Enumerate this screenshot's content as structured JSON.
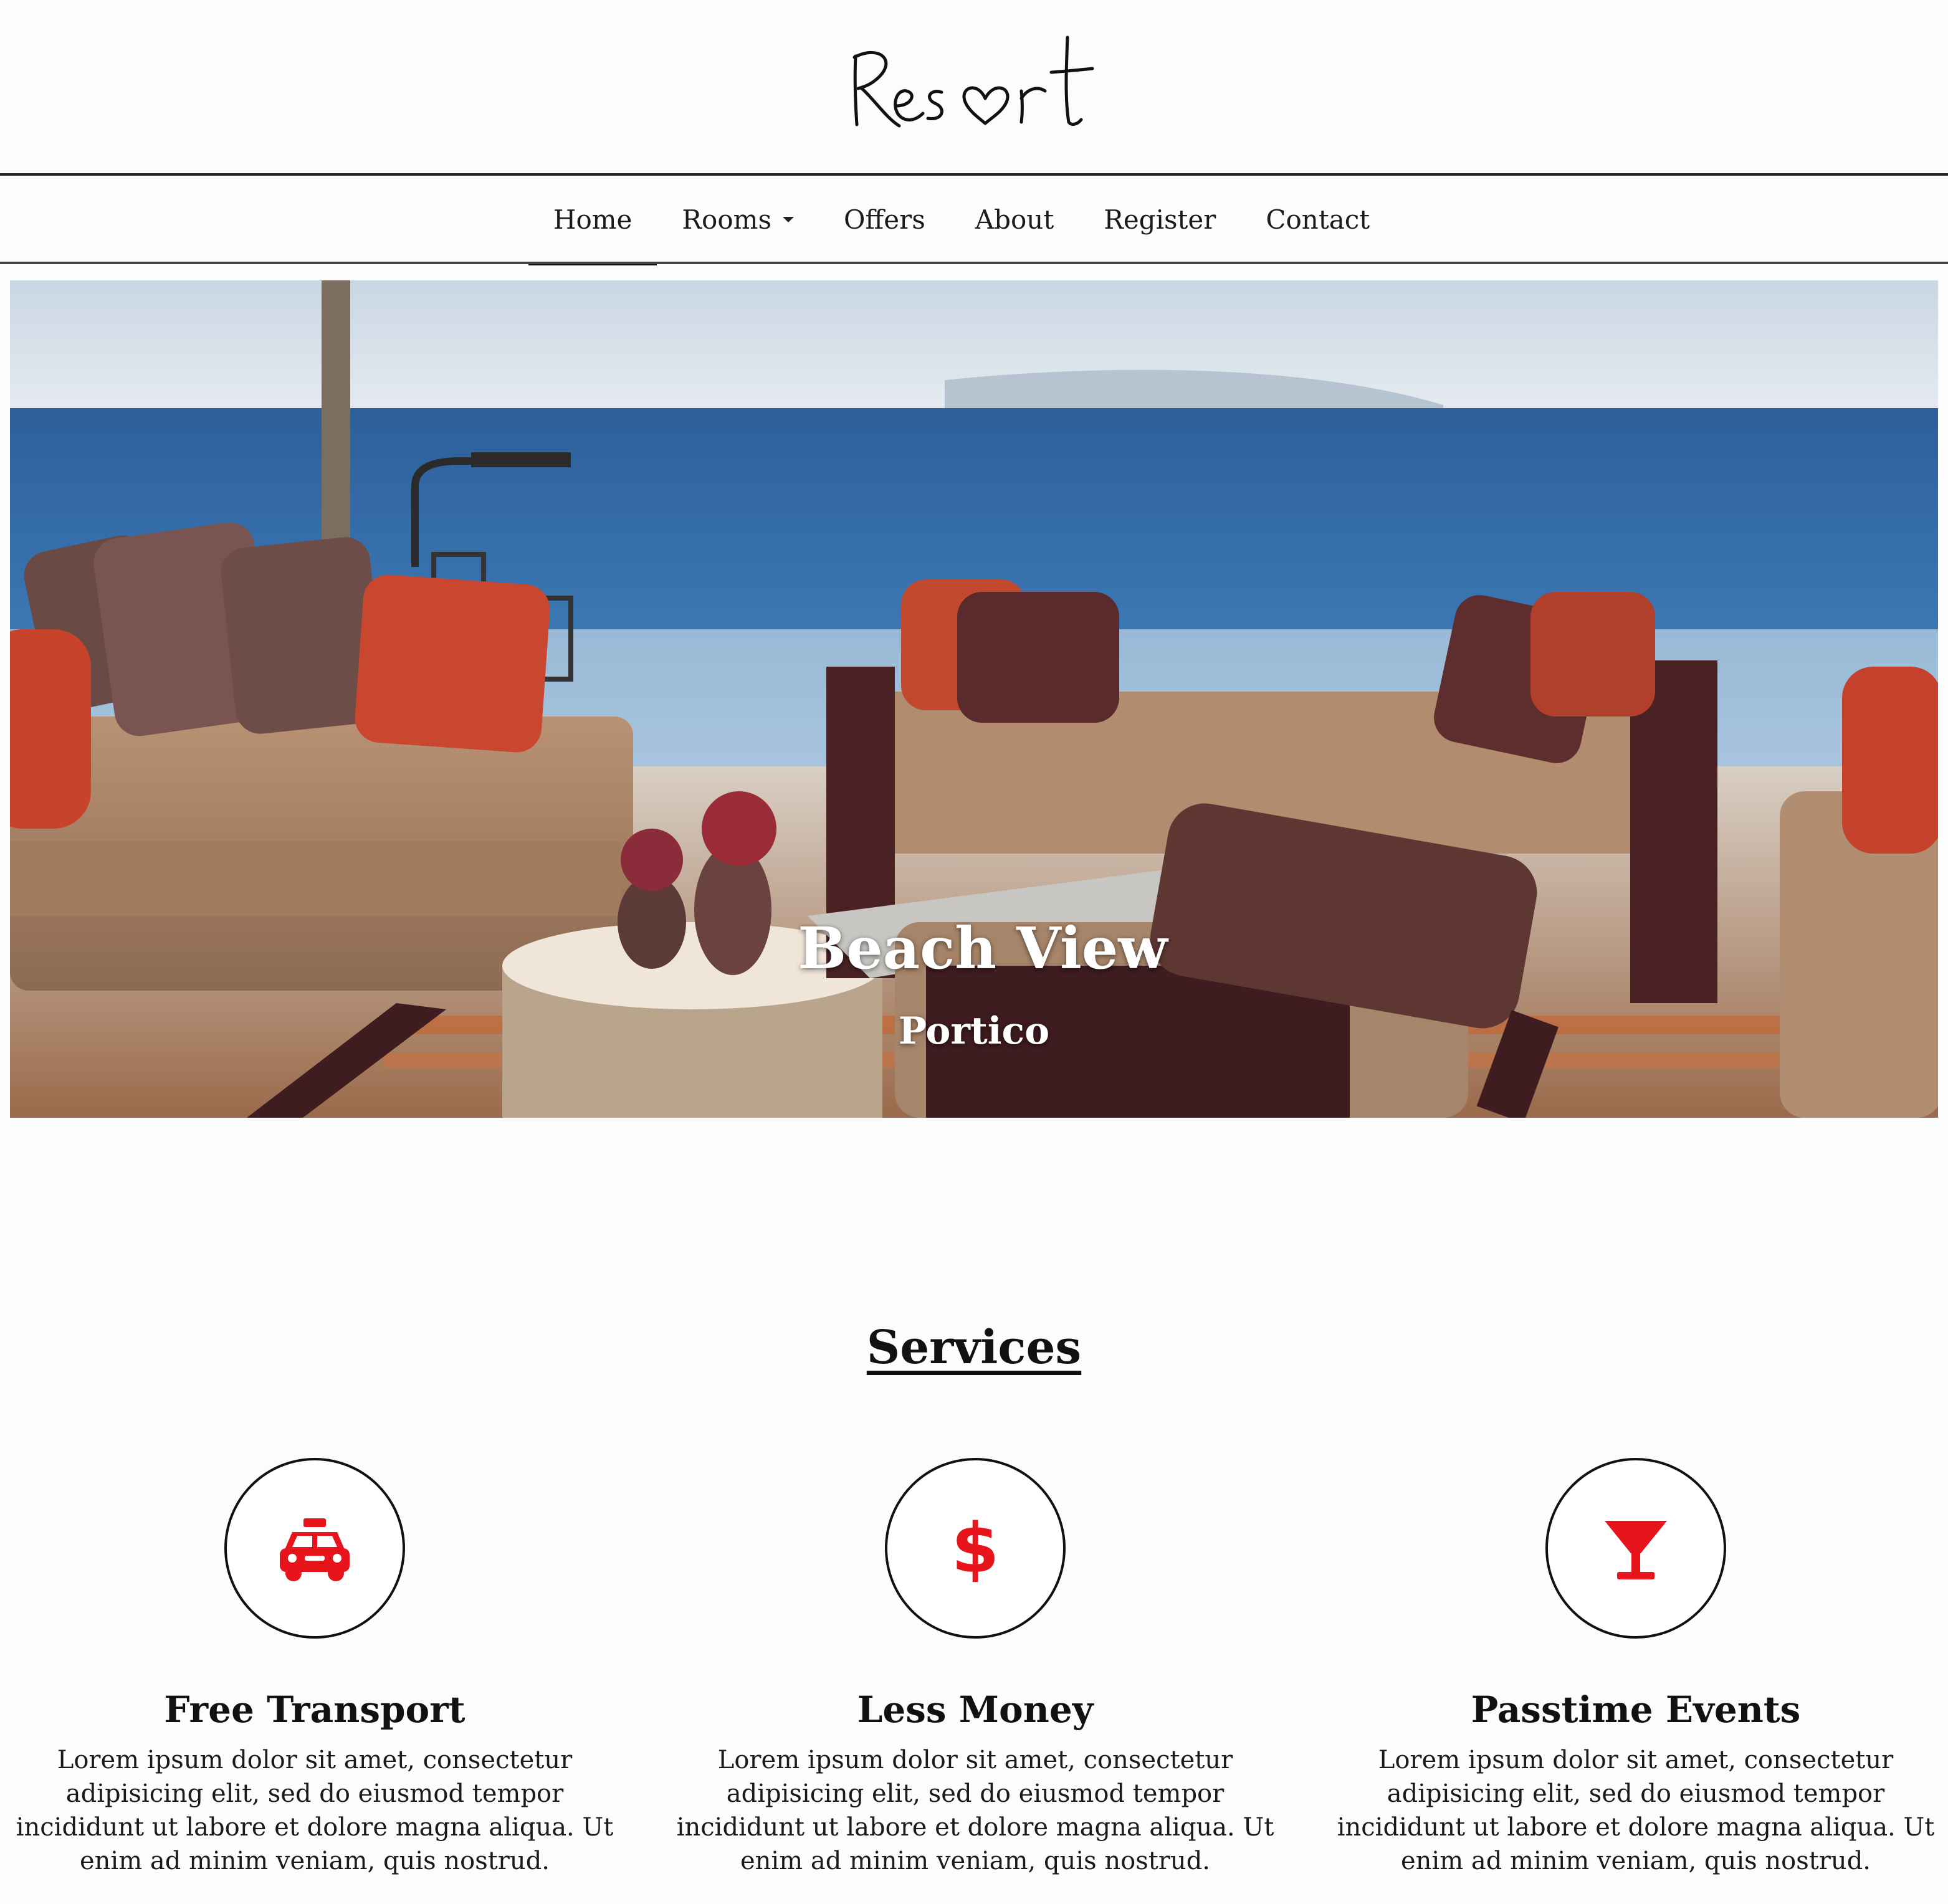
{
  "brand": {
    "logo_text": "Resort"
  },
  "nav": {
    "items": [
      {
        "label": "Home",
        "active": true
      },
      {
        "label": "Rooms",
        "dropdown": true
      },
      {
        "label": "Offers"
      },
      {
        "label": "About"
      },
      {
        "label": "Register"
      },
      {
        "label": "Contact"
      }
    ]
  },
  "hero": {
    "title": "Beach View",
    "subtitle": "Portico"
  },
  "services": {
    "heading": "Services",
    "accent_color": "#e8141b",
    "items": [
      {
        "icon": "taxi-icon",
        "title": "Free Transport",
        "text": "Lorem ipsum dolor sit amet, consectetur adipisicing elit, sed do eiusmod tempor incididunt ut labore et dolore magna aliqua. Ut enim ad minim veniam, quis nostrud."
      },
      {
        "icon": "dollar-icon",
        "title": "Less Money",
        "text": "Lorem ipsum dolor sit amet, consectetur adipisicing elit, sed do eiusmod tempor incididunt ut labore et dolore magna aliqua. Ut enim ad minim veniam, quis nostrud."
      },
      {
        "icon": "cocktail-glass-icon",
        "title": "Passtime Events",
        "text": "Lorem ipsum dolor sit amet, consectetur adipisicing elit, sed do eiusmod tempor incididunt ut labore et dolore magna aliqua. Ut enim ad minim veniam, quis nostrud."
      }
    ]
  }
}
